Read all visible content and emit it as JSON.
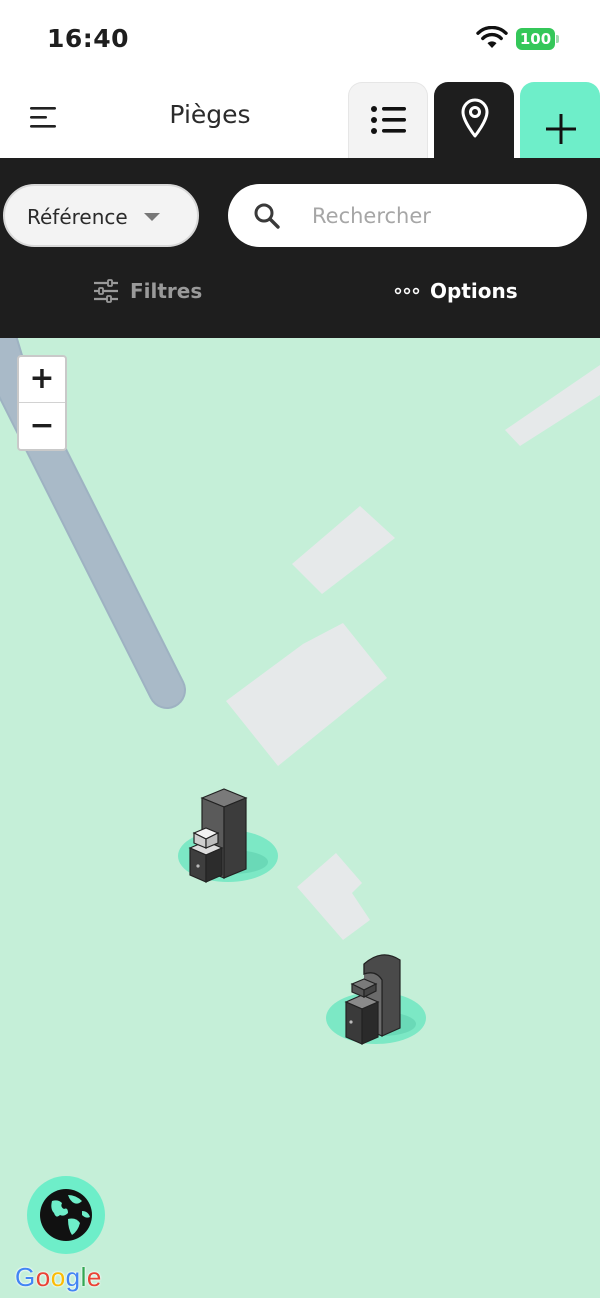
{
  "status_bar": {
    "time": "16:40",
    "battery": "100"
  },
  "header": {
    "title": "Pièges",
    "tabs": [
      {
        "name": "list",
        "icon": "list-icon"
      },
      {
        "name": "map",
        "icon": "map-pin-icon",
        "active": true
      },
      {
        "name": "add",
        "icon": "plus-icon"
      }
    ]
  },
  "toolbar": {
    "reference_select": {
      "value": "Référence"
    },
    "search": {
      "placeholder": "Rechercher",
      "value": ""
    },
    "filters_label": "Filtres",
    "options_label": "Options"
  },
  "map": {
    "zoom_in_label": "+",
    "zoom_out_label": "−",
    "attribution": "Google",
    "markers": [
      {
        "type": "trap"
      },
      {
        "type": "trap"
      }
    ]
  },
  "colors": {
    "accent": "#6eeec9",
    "toolbar_bg": "#1e1e1e",
    "map_bg": "#c5efd8",
    "road": "#a7b8c6",
    "building": "#e6e9ea"
  }
}
